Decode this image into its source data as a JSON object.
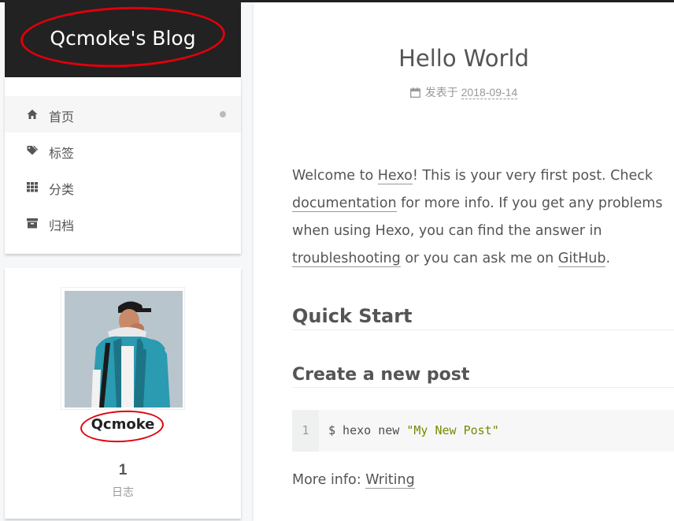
{
  "site": {
    "title": "Qcmoke's Blog"
  },
  "menu": {
    "items": [
      {
        "label": "首页",
        "icon": "home-icon",
        "active": true
      },
      {
        "label": "标签",
        "icon": "tags-icon"
      },
      {
        "label": "分类",
        "icon": "grid-icon"
      },
      {
        "label": "归档",
        "icon": "archive-icon"
      }
    ]
  },
  "profile": {
    "name": "Qcmoke",
    "posts_count": "1",
    "posts_label": "日志"
  },
  "post": {
    "title": "Hello World",
    "meta_prefix": "发表于",
    "date": "2018-09-14",
    "intro": {
      "t1": "Welcome to ",
      "link_hexo": "Hexo",
      "t2": "! This is your very first post. Check ",
      "link_docs": "documentation",
      "t3": " for more info. If you get any problems when using Hexo, you can find the answer in ",
      "link_troubleshooting": "troubleshooting",
      "t4": " or you can ask me on ",
      "link_github": "GitHub",
      "t5": "."
    },
    "h_quick_start": "Quick Start",
    "h_create_post": "Create a new post",
    "code": {
      "line_number": "1",
      "command": "$ hexo new ",
      "string": "\"My New Post\""
    },
    "more_info_prefix": "More info: ",
    "more_info_link": "Writing"
  },
  "colors": {
    "brand_bg": "#222222",
    "annotation_red": "#e0000b",
    "code_string": "#718c00"
  }
}
